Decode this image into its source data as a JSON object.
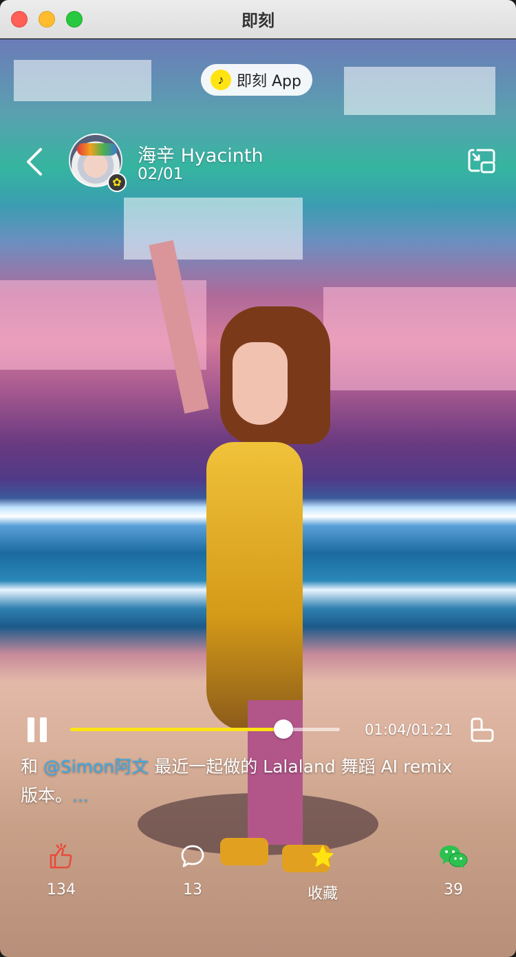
{
  "window": {
    "title": "即刻"
  },
  "app_badge": {
    "label": "即刻 App",
    "logo_glyph": "♪",
    "accent": "#ffe411"
  },
  "header": {
    "back_icon": "chevron-left-icon",
    "username": "海辛 Hyacinth",
    "date": "02/01",
    "pip_icon": "picture-in-picture-icon"
  },
  "player": {
    "state": "playing",
    "time": "01:04/01:21",
    "progress_fraction": 0.79,
    "accent": "#ffe411"
  },
  "caption": {
    "prefix": "和 ",
    "mention": "@Simon阿文",
    "body": " 最近一起做的 Lalaland 舞蹈 AI remix 版本。",
    "more": "...",
    "mention_color": "#3aa8e6"
  },
  "actions": [
    {
      "name": "like",
      "icon": "thumbs-up-icon",
      "label": "134",
      "color": "#e84a3a"
    },
    {
      "name": "comment",
      "icon": "comment-bubble-icon",
      "label": "13",
      "color": "#ffffff"
    },
    {
      "name": "collect",
      "icon": "star-icon",
      "label": "收藏",
      "color": "#ffe411"
    },
    {
      "name": "share-wechat",
      "icon": "wechat-icon",
      "label": "39",
      "color": "#2dc150"
    }
  ]
}
